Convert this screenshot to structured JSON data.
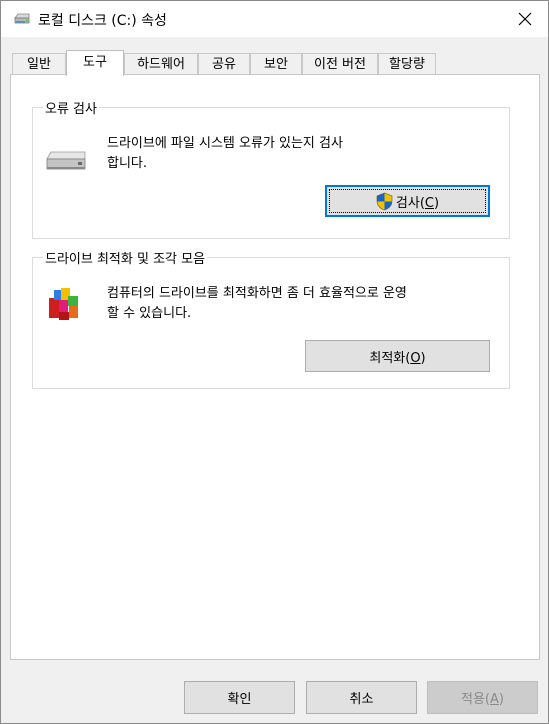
{
  "window": {
    "title": "로컬 디스크 (C:) 속성",
    "icon": "drive-icon"
  },
  "tabs": [
    {
      "label": "일반",
      "active": false
    },
    {
      "label": "도구",
      "active": true
    },
    {
      "label": "하드웨어",
      "active": false
    },
    {
      "label": "공유",
      "active": false
    },
    {
      "label": "보안",
      "active": false
    },
    {
      "label": "이전 버전",
      "active": false
    },
    {
      "label": "할당량",
      "active": false
    }
  ],
  "error_check": {
    "title": "오류 검사",
    "desc_line1": "드라이브에 파일 시스템 오류가 있는지 검사",
    "desc_line2": "합니다.",
    "button_text": "검사(",
    "button_key": "C",
    "button_close": ")"
  },
  "optimize": {
    "title": "드라이브 최적화 및 조각 모음",
    "desc_line1": "컴퓨터의 드라이브를 최적화하면 좀 더 효율적으로 운영",
    "desc_line2": "할 수 있습니다.",
    "button_text": "최적화(",
    "button_key": "O",
    "button_close": ")"
  },
  "footer": {
    "ok": "확인",
    "cancel": "취소",
    "apply_text": "적용(",
    "apply_key": "A",
    "apply_close": ")"
  },
  "colors": {
    "focus": "#0078d7",
    "button": "#e1e1e1",
    "disabled_text": "#8a8a8a"
  }
}
